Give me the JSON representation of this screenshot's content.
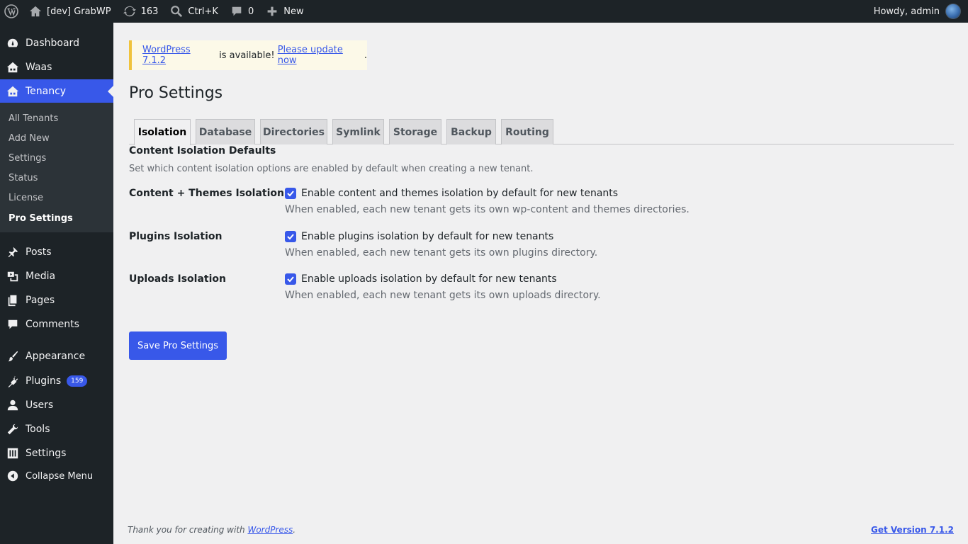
{
  "adminbar": {
    "site_name": "[dev] GrabWP",
    "updates_count": "163",
    "search_shortcut": "Ctrl+K",
    "comments_count": "0",
    "new_label": "New",
    "greeting": "Howdy, admin"
  },
  "sidebar": {
    "items": [
      {
        "label": "Dashboard",
        "icon": "dashboard-icon"
      },
      {
        "label": "Waas",
        "icon": "waas-icon"
      },
      {
        "label": "Tenancy",
        "icon": "tenancy-icon"
      },
      {
        "label": "Posts",
        "icon": "pin-icon"
      },
      {
        "label": "Media",
        "icon": "media-icon"
      },
      {
        "label": "Pages",
        "icon": "pages-icon"
      },
      {
        "label": "Comments",
        "icon": "comment-icon"
      },
      {
        "label": "Appearance",
        "icon": "brush-icon"
      },
      {
        "label": "Plugins",
        "icon": "plug-icon",
        "badge": "159"
      },
      {
        "label": "Users",
        "icon": "user-icon"
      },
      {
        "label": "Tools",
        "icon": "wrench-icon"
      },
      {
        "label": "Settings",
        "icon": "sliders-icon"
      },
      {
        "label": "Collapse Menu",
        "icon": "collapse-icon"
      }
    ],
    "submenu": [
      "All Tenants",
      "Add New",
      "Settings",
      "Status",
      "License",
      "Pro Settings"
    ]
  },
  "notice": {
    "link_version": "WordPress 7.1.2",
    "middle_text": " is available! ",
    "link_update": "Please update now",
    "end": "."
  },
  "page": {
    "title": "Pro Settings",
    "tabs": [
      "Isolation",
      "Database",
      "Directories",
      "Symlink",
      "Storage",
      "Backup",
      "Routing"
    ],
    "active_tab": "Isolation",
    "section_title": "Content Isolation Defaults",
    "section_desc": "Set which content isolation options are enabled by default when creating a new tenant.",
    "rows": [
      {
        "label": "Content + Themes Isolation",
        "checkbox_label": "Enable content and themes isolation by default for new tenants",
        "checked": true,
        "desc": "When enabled, each new tenant gets its own wp-content and themes directories."
      },
      {
        "label": "Plugins Isolation",
        "checkbox_label": "Enable plugins isolation by default for new tenants",
        "checked": true,
        "desc": "When enabled, each new tenant gets its own plugins directory."
      },
      {
        "label": "Uploads Isolation",
        "checkbox_label": "Enable uploads isolation by default for new tenants",
        "checked": true,
        "desc": "When enabled, each new tenant gets its own uploads directory."
      }
    ],
    "save_label": "Save Pro Settings"
  },
  "footer": {
    "thanks_prefix": "Thank you for creating with ",
    "wordpress_link": "WordPress",
    "thanks_suffix": ".",
    "version_link": "Get Version 7.1.2"
  },
  "colors": {
    "accent": "#3858e9",
    "sidebar_bg": "#1d2327",
    "notice_border": "#f0c33c"
  }
}
